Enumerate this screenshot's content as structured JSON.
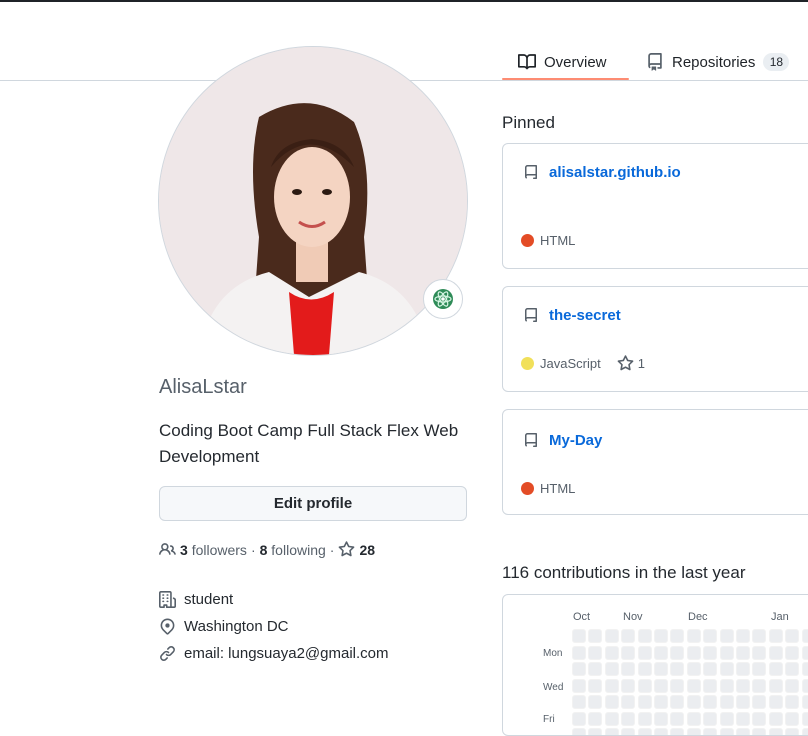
{
  "tabs": [
    {
      "label": "Overview",
      "icon": "book-icon"
    },
    {
      "label": "Repositories",
      "icon": "repo-icon",
      "count": "18"
    }
  ],
  "profile": {
    "login": "AlisaLstar",
    "bio": "Coding Boot Camp Full Stack Flex Web Development",
    "edit_label": "Edit profile",
    "followers_count": "3",
    "followers_label": "followers",
    "following_count": "8",
    "following_label": "following",
    "stars_count": "28",
    "sep": "·",
    "company": "student",
    "location": "Washington DC",
    "email": "email: lungsuaya2@gmail.com",
    "status_emoji": "atom-icon"
  },
  "pinned": {
    "title": "Pinned",
    "repos": [
      {
        "name": "alisalstar.github.io",
        "language": "HTML",
        "color": "#e34c26"
      },
      {
        "name": "the-secret",
        "language": "JavaScript",
        "color": "#f1e05a",
        "stars": "1"
      },
      {
        "name": "My-Day",
        "language": "HTML",
        "color": "#e34c26"
      }
    ]
  },
  "contributions": {
    "title": "116 contributions in the last year",
    "months": [
      "Oct",
      "Nov",
      "Dec",
      "Jan"
    ],
    "days": [
      "Mon",
      "Wed",
      "Fri"
    ]
  },
  "colors": {
    "accent": "#fd8c73",
    "link": "#0969da",
    "border": "#d0d7de"
  }
}
